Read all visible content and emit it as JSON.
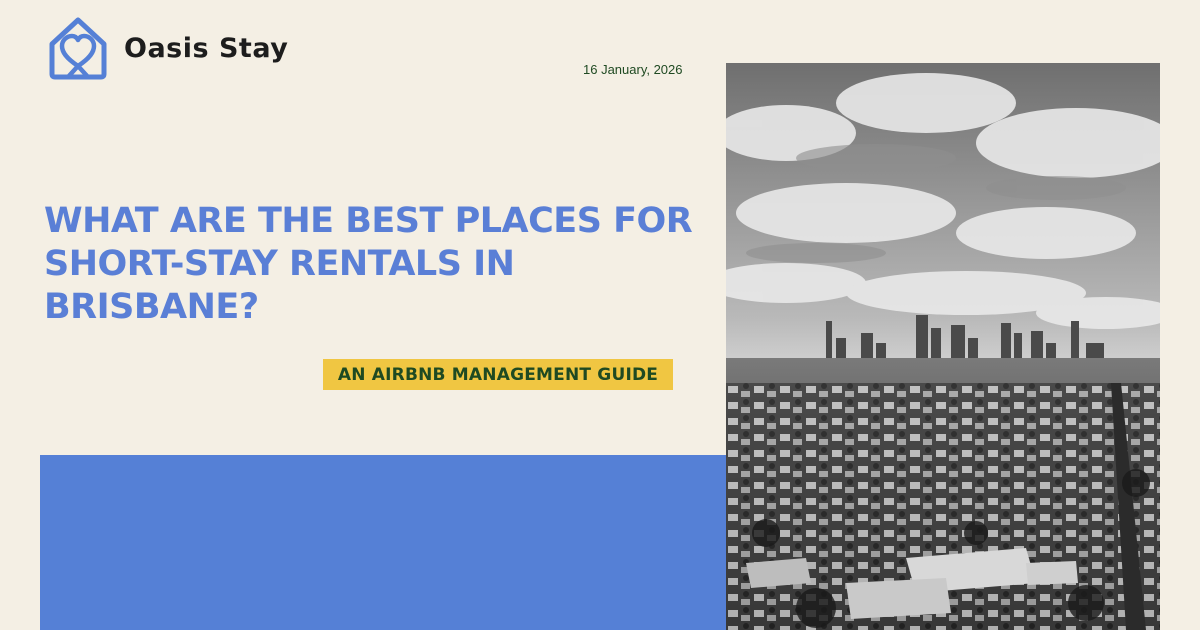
{
  "brand": {
    "name": "Oasis Stay",
    "logo_icon": "house-heart-icon",
    "accent_color": "#5580d6"
  },
  "article": {
    "date": "16 January, 2026",
    "title": "What are the best places for short-stay rentals in Brisbane?",
    "subtitle": "An Airbnb Management Guide"
  },
  "colors": {
    "background": "#f4efe4",
    "headline": "#5a7fd6",
    "badge": "#f0c642",
    "badge_text": "#1f4a22",
    "block": "#5580d6"
  },
  "photo": {
    "description_icon": "city-skyline-photo"
  }
}
